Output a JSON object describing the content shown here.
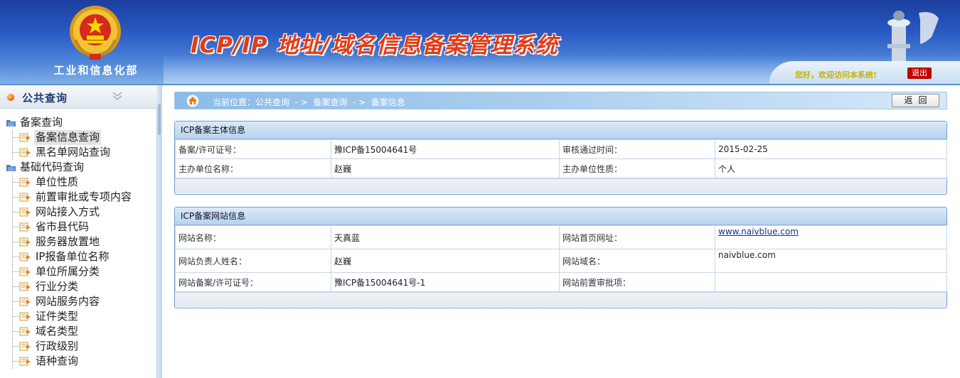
{
  "header": {
    "ministry_name": "工业和信息化部",
    "system_title": "ICP/IP 地址/域名信息备案管理系统",
    "welcome_text": "您好，欢迎访问本系统!",
    "logout_label": "退出",
    "colors": {
      "title_red": "#e43b16",
      "header_blue": "#2a5bc4",
      "logout_red": "#c00000"
    }
  },
  "sidebar": {
    "title": "公共查询",
    "groups": [
      {
        "label": "备案查询",
        "items": [
          {
            "label": "备案信息查询",
            "active": true
          },
          {
            "label": "黑名单网站查询"
          }
        ]
      },
      {
        "label": "基础代码查询",
        "items": [
          {
            "label": "单位性质"
          },
          {
            "label": "前置审批或专项内容"
          },
          {
            "label": "网站接入方式"
          },
          {
            "label": "省市县代码"
          },
          {
            "label": "服务器放置地"
          },
          {
            "label": "IP报备单位名称"
          },
          {
            "label": "单位所属分类"
          },
          {
            "label": "行业分类"
          },
          {
            "label": "网站服务内容"
          },
          {
            "label": "证件类型"
          },
          {
            "label": "域名类型"
          },
          {
            "label": "行政级别"
          },
          {
            "label": "语种查询"
          }
        ]
      }
    ]
  },
  "breadcrumb": {
    "text": "当前位置：公共查询  - >  备案查询  - >  备案信息"
  },
  "back_button_label": "返回",
  "entity_panel": {
    "title": "ICP备案主体信息",
    "rows": [
      {
        "k1": "备案/许可证号：",
        "v1": "豫ICP备15004641号",
        "k2": "审核通过时间：",
        "v2": "2015-02-25"
      },
      {
        "k1": "主办单位名称：",
        "v1": "赵巍",
        "k2": "主办单位性质：",
        "v2": "个人"
      }
    ]
  },
  "website_panel": {
    "title": "ICP备案网站信息",
    "rows": [
      {
        "k1": "网站名称：",
        "v1": "天真蓝",
        "k2": "网站首页网址：",
        "v2": "www.naivblue.com"
      },
      {
        "k1": "网站负责人姓名：",
        "v1": "赵巍",
        "k2": "网站域名：",
        "v2": "naivblue.com"
      },
      {
        "k1": "网站备案/许可证号：",
        "v1": "豫ICP备15004641号-1",
        "k2": "网站前置审批项：",
        "v2": ""
      }
    ]
  }
}
